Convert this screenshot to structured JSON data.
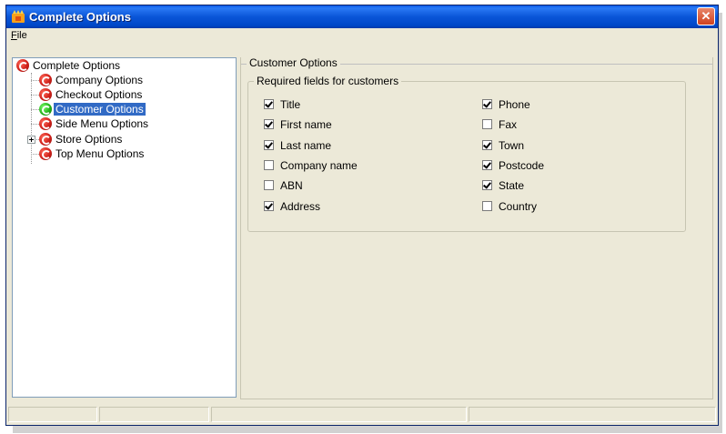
{
  "window": {
    "title": "Complete Options",
    "close_glyph": "✕"
  },
  "menu": {
    "file_accel": "F",
    "file_rest": "ile"
  },
  "tree": {
    "items": [
      {
        "label": "Complete Options",
        "icon": "options-icon",
        "selected": false
      },
      {
        "label": "Company Options",
        "icon": "options-icon",
        "selected": false
      },
      {
        "label": "Checkout Options",
        "icon": "options-icon",
        "selected": false
      },
      {
        "label": "Customer Options",
        "icon": "options-icon-active",
        "selected": true
      },
      {
        "label": "Side Menu Options",
        "icon": "options-icon",
        "selected": false
      },
      {
        "label": "Store Options",
        "icon": "options-icon",
        "selected": false,
        "expandable": true
      },
      {
        "label": "Top Menu Options",
        "icon": "options-icon",
        "selected": false
      }
    ]
  },
  "panel": {
    "title": "Customer Options",
    "group_title": "Required fields for customers",
    "left_fields": [
      {
        "label": "Title",
        "checked": true
      },
      {
        "label": "First name",
        "checked": true
      },
      {
        "label": "Last name",
        "checked": true
      },
      {
        "label": "Company name",
        "checked": false
      },
      {
        "label": "ABN",
        "checked": false
      },
      {
        "label": "Address",
        "checked": true
      }
    ],
    "right_fields": [
      {
        "label": "Phone",
        "checked": true
      },
      {
        "label": "Fax",
        "checked": false
      },
      {
        "label": "Town",
        "checked": true
      },
      {
        "label": "Postcode",
        "checked": true
      },
      {
        "label": "State",
        "checked": true
      },
      {
        "label": "Country",
        "checked": false
      }
    ]
  },
  "colors": {
    "title_bar": "#0a55d8",
    "selection": "#316ac5",
    "window_bg": "#ece9d8"
  }
}
